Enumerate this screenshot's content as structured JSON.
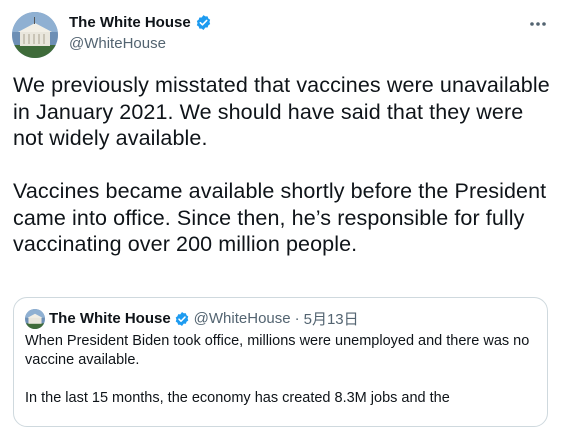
{
  "author": {
    "name": "The White House",
    "handle": "@WhiteHouse",
    "verified_color": "#1d9bf0"
  },
  "tweet": {
    "paragraphs": [
      "We previously misstated that vaccines were unavailable in January 2021. We should have said that they were not widely available.",
      "Vaccines became available shortly before the President came into office. Since then, he’s responsible for fully vaccinating over 200 million people."
    ]
  },
  "quoted_tweet": {
    "name": "The White House",
    "handle": "@WhiteHouse",
    "separator": "·",
    "date": "5月13日",
    "paragraphs": [
      "When President Biden took office, millions were unemployed and there was no vaccine available.",
      "In the last 15 months, the economy has created 8.3M jobs and the"
    ]
  },
  "icons": {
    "more": "more-icon",
    "verified": "verified-badge-icon"
  }
}
